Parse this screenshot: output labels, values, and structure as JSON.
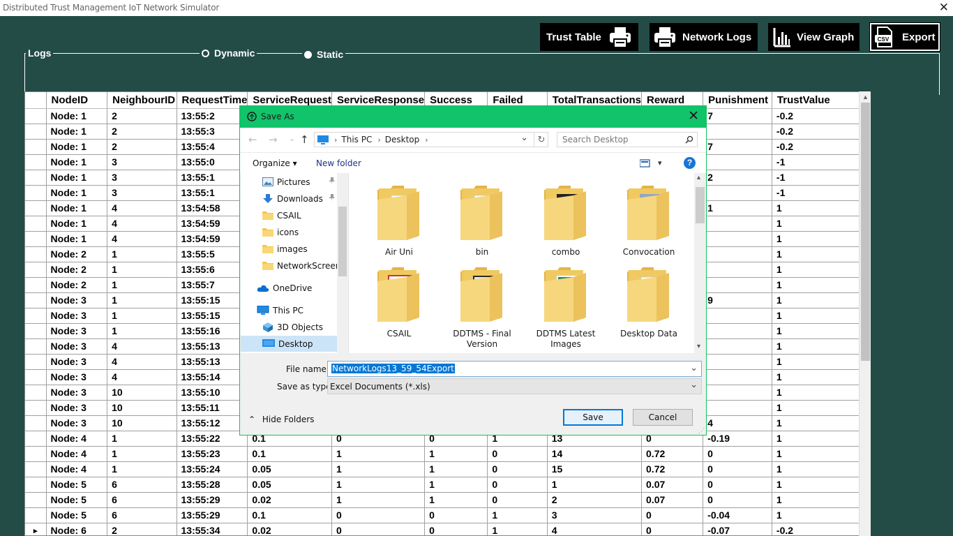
{
  "window": {
    "title": "Distributed Trust Management  IoT Network Simulator",
    "close": "✕"
  },
  "toolbar": {
    "trust_table": "Trust Table",
    "network_logs": "Network Logs",
    "view_graph": "View Graph",
    "export": "Export",
    "csv_icon_text": "CSV"
  },
  "logs": {
    "label": "Logs",
    "dynamic": "Dynamic",
    "static": "Static",
    "selected": "static"
  },
  "grid": {
    "columns": [
      "NodeID",
      "NeighbourID",
      "RequestTime",
      "ServiceRequest",
      "ServiceResponse",
      "Success",
      "Failed",
      "TotalTransactions",
      "Reward",
      "Punishment",
      "TrustValue"
    ],
    "rows": [
      [
        "Node: 1",
        "2",
        "13:55:2",
        "",
        "",
        "",
        "",
        "",
        "",
        "7",
        "-0.2"
      ],
      [
        "Node: 1",
        "2",
        "13:55:3",
        "",
        "",
        "",
        "",
        "",
        "",
        "",
        "-0.2"
      ],
      [
        "Node: 1",
        "2",
        "13:55:4",
        "",
        "",
        "",
        "",
        "",
        "",
        "7",
        "-0.2"
      ],
      [
        "Node: 1",
        "3",
        "13:55:0",
        "",
        "",
        "",
        "",
        "",
        "",
        "",
        "-1"
      ],
      [
        "Node: 1",
        "3",
        "13:55:1",
        "",
        "",
        "",
        "",
        "",
        "",
        "2",
        "-1"
      ],
      [
        "Node: 1",
        "3",
        "13:55:1",
        "",
        "",
        "",
        "",
        "",
        "",
        "",
        "-1"
      ],
      [
        "Node: 1",
        "4",
        "13:54:58",
        "",
        "",
        "",
        "",
        "",
        "",
        "1",
        "1"
      ],
      [
        "Node: 1",
        "4",
        "13:54:59",
        "",
        "",
        "",
        "",
        "",
        "",
        "",
        "1"
      ],
      [
        "Node: 1",
        "4",
        "13:54:59",
        "",
        "",
        "",
        "",
        "",
        "",
        "",
        "1"
      ],
      [
        "Node: 2",
        "1",
        "13:55:5",
        "",
        "",
        "",
        "",
        "",
        "",
        "",
        "1"
      ],
      [
        "Node: 2",
        "1",
        "13:55:6",
        "",
        "",
        "",
        "",
        "",
        "",
        "",
        "1"
      ],
      [
        "Node: 2",
        "1",
        "13:55:7",
        "",
        "",
        "",
        "",
        "",
        "",
        "",
        "1"
      ],
      [
        "Node: 3",
        "1",
        "13:55:15",
        "",
        "",
        "",
        "",
        "",
        "",
        "9",
        "1"
      ],
      [
        "Node: 3",
        "1",
        "13:55:15",
        "",
        "",
        "",
        "",
        "",
        "",
        "",
        "1"
      ],
      [
        "Node: 3",
        "1",
        "13:55:16",
        "",
        "",
        "",
        "",
        "",
        "",
        "",
        "1"
      ],
      [
        "Node: 3",
        "4",
        "13:55:13",
        "",
        "",
        "",
        "",
        "",
        "",
        "",
        "1"
      ],
      [
        "Node: 3",
        "4",
        "13:55:13",
        "",
        "",
        "",
        "",
        "",
        "",
        "",
        "1"
      ],
      [
        "Node: 3",
        "4",
        "13:55:14",
        "",
        "",
        "",
        "",
        "",
        "",
        "",
        "1"
      ],
      [
        "Node: 3",
        "10",
        "13:55:10",
        "",
        "",
        "",
        "",
        "",
        "",
        "",
        "1"
      ],
      [
        "Node: 3",
        "10",
        "13:55:11",
        "",
        "",
        "",
        "",
        "",
        "",
        "",
        "1"
      ],
      [
        "Node: 3",
        "10",
        "13:55:12",
        "",
        "",
        "",
        "",
        "",
        "",
        "4",
        "1"
      ],
      [
        "Node: 4",
        "1",
        "13:55:22",
        "0.1",
        "0",
        "0",
        "1",
        "13",
        "0",
        "-0.19",
        "1"
      ],
      [
        "Node: 4",
        "1",
        "13:55:23",
        "0.1",
        "1",
        "1",
        "0",
        "14",
        "0.72",
        "0",
        "1"
      ],
      [
        "Node: 4",
        "1",
        "13:55:24",
        "0.05",
        "1",
        "1",
        "0",
        "15",
        "0.72",
        "0",
        "1"
      ],
      [
        "Node: 5",
        "6",
        "13:55:28",
        "0.05",
        "1",
        "1",
        "0",
        "1",
        "0.07",
        "0",
        "1"
      ],
      [
        "Node: 5",
        "6",
        "13:55:29",
        "0.02",
        "1",
        "1",
        "0",
        "2",
        "0.07",
        "0",
        "1"
      ],
      [
        "Node: 5",
        "6",
        "13:55:29",
        "0.1",
        "0",
        "0",
        "1",
        "3",
        "0",
        "-0.04",
        "1"
      ],
      [
        "Node: 6",
        "2",
        "13:55:34",
        "0.02",
        "0",
        "0",
        "1",
        "4",
        "0",
        "-0.07",
        "-0.2"
      ]
    ],
    "current_row_marker": "▸",
    "current_row_index": 27
  },
  "dialog": {
    "title": "Save As",
    "close": "✕",
    "back": "←",
    "forward": "→",
    "history": "⌄",
    "up": "↑",
    "path": [
      "This PC",
      "Desktop"
    ],
    "path_sep": "›",
    "path_dropdown": "⌄",
    "refresh": "↻",
    "search_placeholder": "Search Desktop",
    "organize": "Organize ▾",
    "new_folder": "New folder",
    "view_dropdown": "▾",
    "help": "?",
    "nav": [
      {
        "label": "Pictures",
        "pinned": true,
        "icon": "pictures-icon"
      },
      {
        "label": "Downloads",
        "pinned": true,
        "icon": "downloads-icon"
      },
      {
        "label": "CSAIL",
        "icon": "folder-icon"
      },
      {
        "label": "icons",
        "icon": "folder-icon"
      },
      {
        "label": "images",
        "icon": "folder-icon"
      },
      {
        "label": "NetworkScreens",
        "icon": "folder-icon"
      },
      {
        "label": "OneDrive",
        "icon": "onedrive-icon"
      },
      {
        "label": "This PC",
        "icon": "this-pc-icon"
      },
      {
        "label": "3D Objects",
        "icon": "3d-objects-icon"
      },
      {
        "label": "Desktop",
        "icon": "desktop-icon",
        "selected": true
      }
    ],
    "pin_glyph": "📌",
    "files": [
      {
        "label": "Air Uni",
        "kind": "docs"
      },
      {
        "label": "bin",
        "kind": "docs"
      },
      {
        "label": "combo",
        "kind": "dark"
      },
      {
        "label": "Convocation",
        "kind": "photo"
      },
      {
        "label": "CSAIL",
        "kind": "pdf"
      },
      {
        "label": "DDTMS - Final Version",
        "kind": "book"
      },
      {
        "label": "DDTMS Latest Images",
        "kind": "green"
      },
      {
        "label": "Desktop Data",
        "kind": "docs"
      }
    ],
    "file_name_label": "File name:",
    "file_name_value": "NetworkLogs13_59_54Export",
    "save_type_label": "Save as type:",
    "save_type_value": "Excel Documents (*.xls)",
    "dropdown_glyph": "⌄",
    "hide_folders": "Hide Folders",
    "hide_folders_glyph": "⌃",
    "save": "Save",
    "cancel": "Cancel",
    "scroll_up": "▴",
    "scroll_down": "▾"
  },
  "colors": {
    "background": "#234c47",
    "dialog_title": "#11c36a",
    "selection": "#0078d7"
  }
}
